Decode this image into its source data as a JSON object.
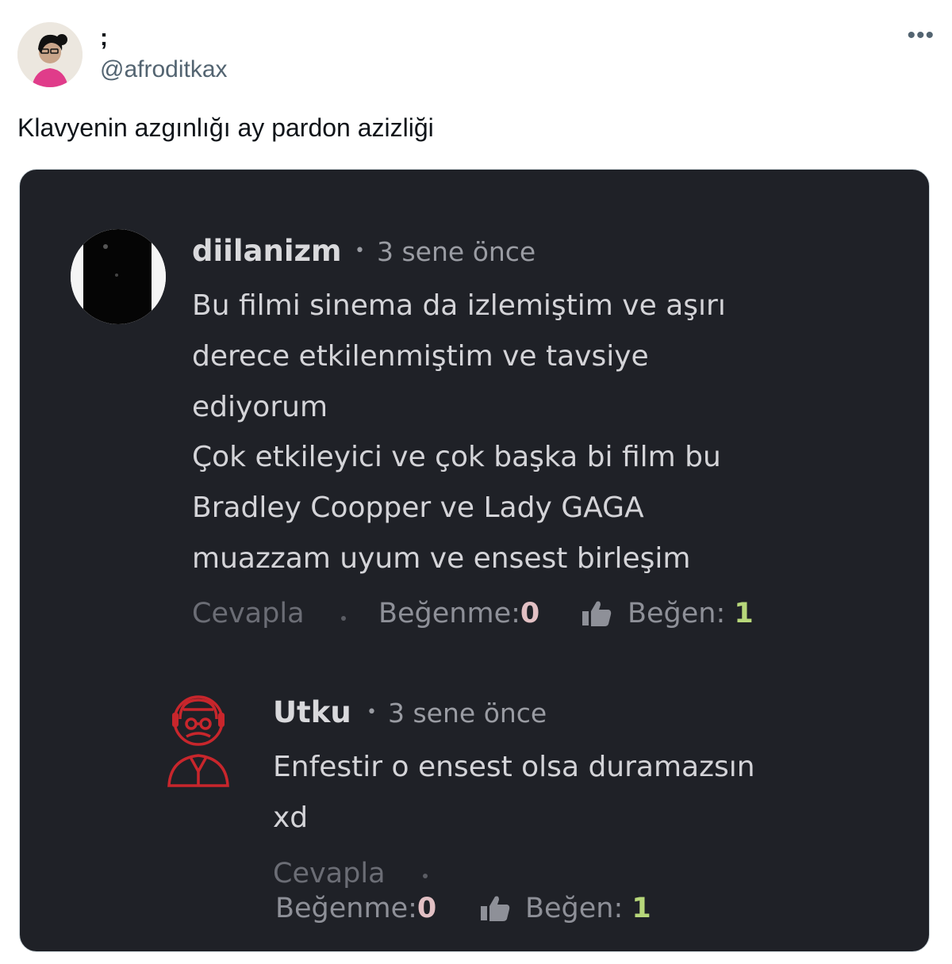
{
  "tweet": {
    "display_name": ";",
    "handle": "@afroditkax",
    "more_icon": "more-horizontal-icon",
    "text": "Klavyenin azgınlığı ay pardon azizliği"
  },
  "comments": [
    {
      "username": "diilanizm",
      "time": "3 sene önce",
      "lines": [
        "Bu filmi sinema da izlemiştim ve aşırı",
        "derece etkilenmiştim ve tavsiye",
        "ediyorum",
        "Çok etkileyici ve çok başka bi film bu",
        "Bradley Coopper ve Lady GAGA",
        "muazzam uyum ve ensest birleşim"
      ],
      "reply_label": "Cevapla",
      "dislike_label": "Beğenme:",
      "dislike_count": "0",
      "like_label": "Beğen:",
      "like_count": "1"
    },
    {
      "username": "Utku",
      "time": "3 sene önce",
      "lines": [
        "Enfestir o ensest olsa duramazsın",
        "xd"
      ],
      "reply_label": "Cevapla",
      "dislike_label": "Beğenme:",
      "dislike_count": "0",
      "like_label": "Beğen:",
      "like_count": "1"
    }
  ],
  "colors": {
    "card_bg": "#1f2127",
    "like_count": "#b7d77a",
    "dislike_count": "#e2c0c4",
    "avatar_red": "#c8262c"
  }
}
